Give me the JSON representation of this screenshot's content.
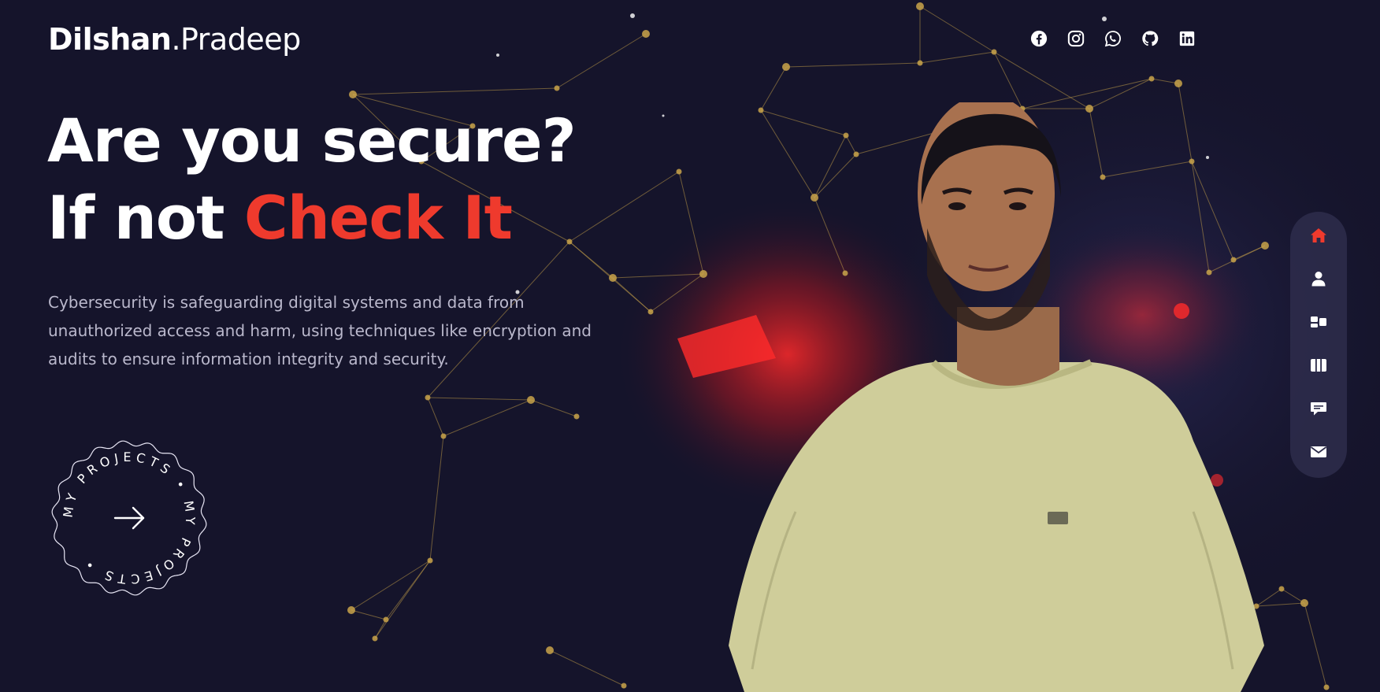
{
  "header": {
    "logo_first": "Dilshan",
    "logo_last": ".Pradeep"
  },
  "socials": [
    {
      "icon": "facebook-icon"
    },
    {
      "icon": "instagram-icon"
    },
    {
      "icon": "whatsapp-icon"
    },
    {
      "icon": "github-icon"
    },
    {
      "icon": "linkedin-icon"
    }
  ],
  "hero": {
    "line1": "Are you secure?",
    "line2_prefix": "If not ",
    "line2_accent": "Check It",
    "description": "Cybersecurity is safeguarding digital systems and data from unauthorized access and harm, using techniques like encryption and audits to ensure information integrity and security."
  },
  "projects_button": {
    "ring_text": "MY PROJECTS • MY PROJECTS •"
  },
  "side_nav": [
    {
      "icon": "home-icon",
      "active": true
    },
    {
      "icon": "user-icon",
      "active": false
    },
    {
      "icon": "grid-icon",
      "active": false
    },
    {
      "icon": "columns-icon",
      "active": false
    },
    {
      "icon": "chat-icon",
      "active": false
    },
    {
      "icon": "mail-icon",
      "active": false
    }
  ],
  "colors": {
    "background": "#15142b",
    "accent": "#ef3a2d",
    "network": "#c9a34a",
    "text_muted": "#bab8cc"
  }
}
